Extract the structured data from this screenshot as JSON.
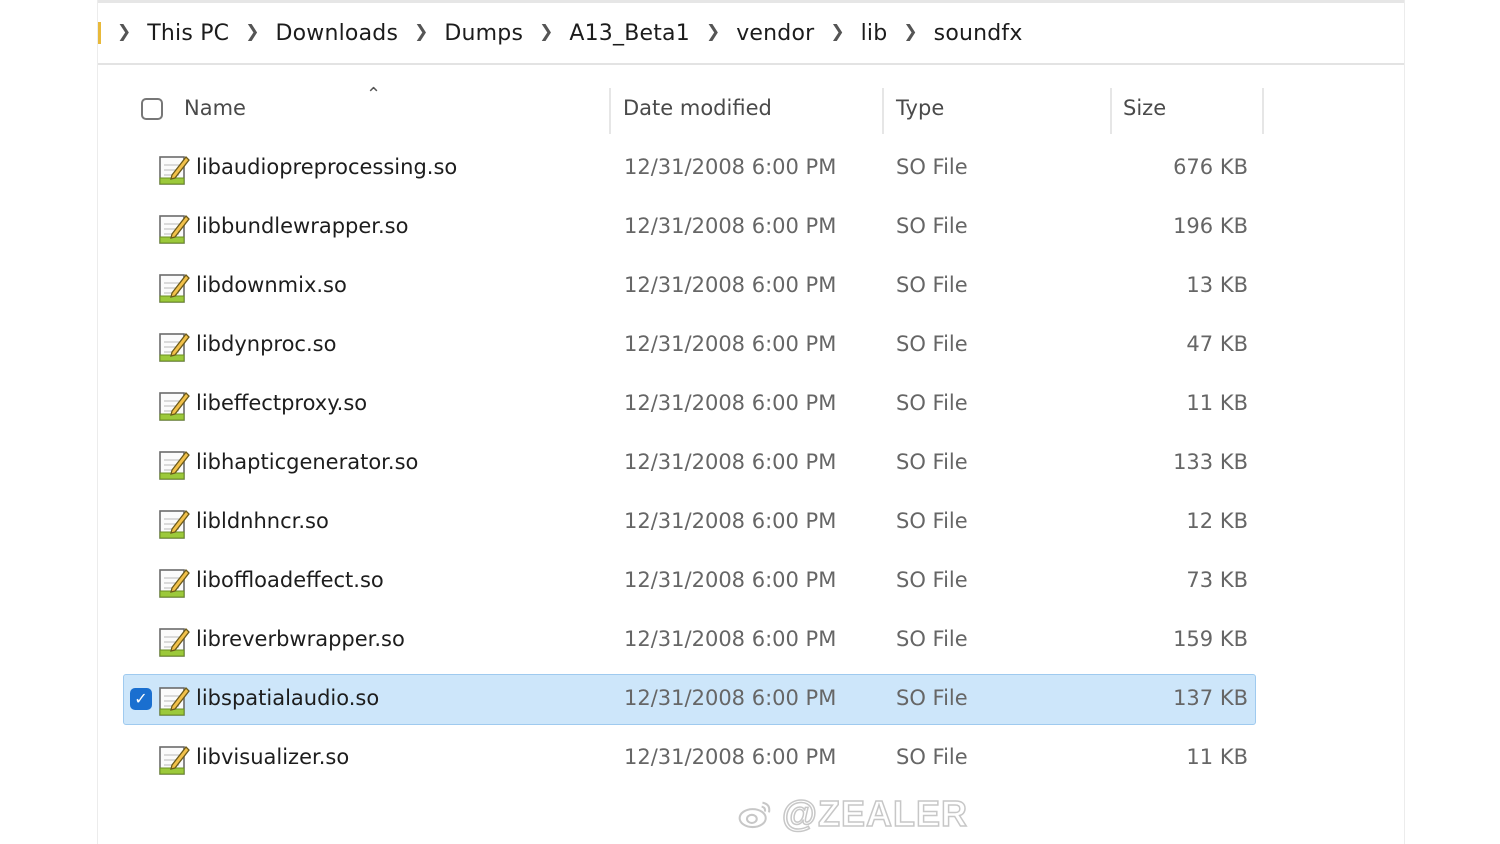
{
  "breadcrumb": {
    "items": [
      "This PC",
      "Downloads",
      "Dumps",
      "A13_Beta1",
      "vendor",
      "lib",
      "soundfx"
    ]
  },
  "columns": {
    "name": "Name",
    "date": "Date modified",
    "type": "Type",
    "size": "Size"
  },
  "files": [
    {
      "name": "libaudiopreprocessing.so",
      "date": "12/31/2008 6:00 PM",
      "type": "SO File",
      "size": "676 KB",
      "selected": false
    },
    {
      "name": "libbundlewrapper.so",
      "date": "12/31/2008 6:00 PM",
      "type": "SO File",
      "size": "196 KB",
      "selected": false
    },
    {
      "name": "libdownmix.so",
      "date": "12/31/2008 6:00 PM",
      "type": "SO File",
      "size": "13 KB",
      "selected": false
    },
    {
      "name": "libdynproc.so",
      "date": "12/31/2008 6:00 PM",
      "type": "SO File",
      "size": "47 KB",
      "selected": false
    },
    {
      "name": "libeffectproxy.so",
      "date": "12/31/2008 6:00 PM",
      "type": "SO File",
      "size": "11 KB",
      "selected": false
    },
    {
      "name": "libhapticgenerator.so",
      "date": "12/31/2008 6:00 PM",
      "type": "SO File",
      "size": "133 KB",
      "selected": false
    },
    {
      "name": "libldnhncr.so",
      "date": "12/31/2008 6:00 PM",
      "type": "SO File",
      "size": "12 KB",
      "selected": false
    },
    {
      "name": "liboffloadeffect.so",
      "date": "12/31/2008 6:00 PM",
      "type": "SO File",
      "size": "73 KB",
      "selected": false
    },
    {
      "name": "libreverbwrapper.so",
      "date": "12/31/2008 6:00 PM",
      "type": "SO File",
      "size": "159 KB",
      "selected": false
    },
    {
      "name": "libspatialaudio.so",
      "date": "12/31/2008 6:00 PM",
      "type": "SO File",
      "size": "137 KB",
      "selected": true
    },
    {
      "name": "libvisualizer.so",
      "date": "12/31/2008 6:00 PM",
      "type": "SO File",
      "size": "11 KB",
      "selected": false
    }
  ],
  "watermark": {
    "text": "@ZEALER",
    "icon": "weibo-icon"
  },
  "colors": {
    "selection_bg": "#cde6fa",
    "selection_border": "#9fcaef",
    "checkbox_checked": "#1a6fd0"
  }
}
